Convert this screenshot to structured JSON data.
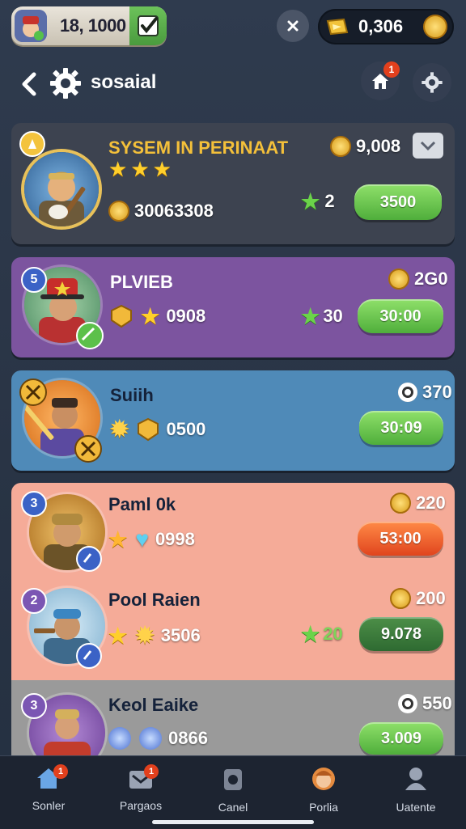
{
  "top_bar": {
    "level_value": "18, 1000",
    "currency_value": "0,306",
    "icons": [
      "player-avatar-icon",
      "check-icon",
      "close-icon",
      "gold-ticket-icon",
      "gold-coin-icon"
    ]
  },
  "header": {
    "title": "sosaial",
    "home_badge": "1",
    "icons": [
      "back-chevron-icon",
      "gear-icon",
      "home-icon",
      "settings-gear-icon"
    ]
  },
  "cards": [
    {
      "name": "SYSEM IN PERINAAT",
      "coin_value": "9,008",
      "currency_value": "30063308",
      "star_count": "2",
      "button_label": "3500",
      "stars_rating": 3,
      "background": "#3d4350",
      "name_color": "#f4c03a"
    },
    {
      "name": "PLVIEB",
      "badge": "5",
      "coin_value": "2G0",
      "stat_value": "0908",
      "star_count": "30",
      "button_label": "30:00",
      "background": "#7c549f"
    },
    {
      "name": "Suiih",
      "coin_value": "370",
      "stat_value": "0500",
      "button_label": "30:09",
      "background": "#4f8ab8"
    },
    {
      "name": "Paml 0k",
      "badge": "3",
      "coin_value": "220",
      "stat_value": "0998",
      "button_label": "53:00",
      "background": "#f5ab98"
    },
    {
      "name": "Pool Raien",
      "badge": "2",
      "coin_value": "200",
      "stat_value": "3506",
      "star_count": "20",
      "button_label": "9.078",
      "background": "#f5ab98"
    },
    {
      "name": "Keol Eaike",
      "badge": "3",
      "coin_value": "550",
      "stat_value": "0866",
      "button_label": "3.009",
      "background": "#9a9a9a"
    }
  ],
  "nav": {
    "items": [
      {
        "label": "Sonler",
        "icon": "home-icon",
        "badge": "1"
      },
      {
        "label": "Pargaos",
        "icon": "inbox-icon",
        "badge": "1"
      },
      {
        "label": "Canel",
        "icon": "shop-icon"
      },
      {
        "label": "Porlia",
        "icon": "profile-avatar-icon"
      },
      {
        "label": "Uatente",
        "icon": "user-icon"
      }
    ]
  },
  "colors": {
    "accent_green": "#5fbf45",
    "accent_orange": "#ef5a26",
    "badge_red": "#e2401d",
    "badge_blue": "#3b62c6"
  }
}
